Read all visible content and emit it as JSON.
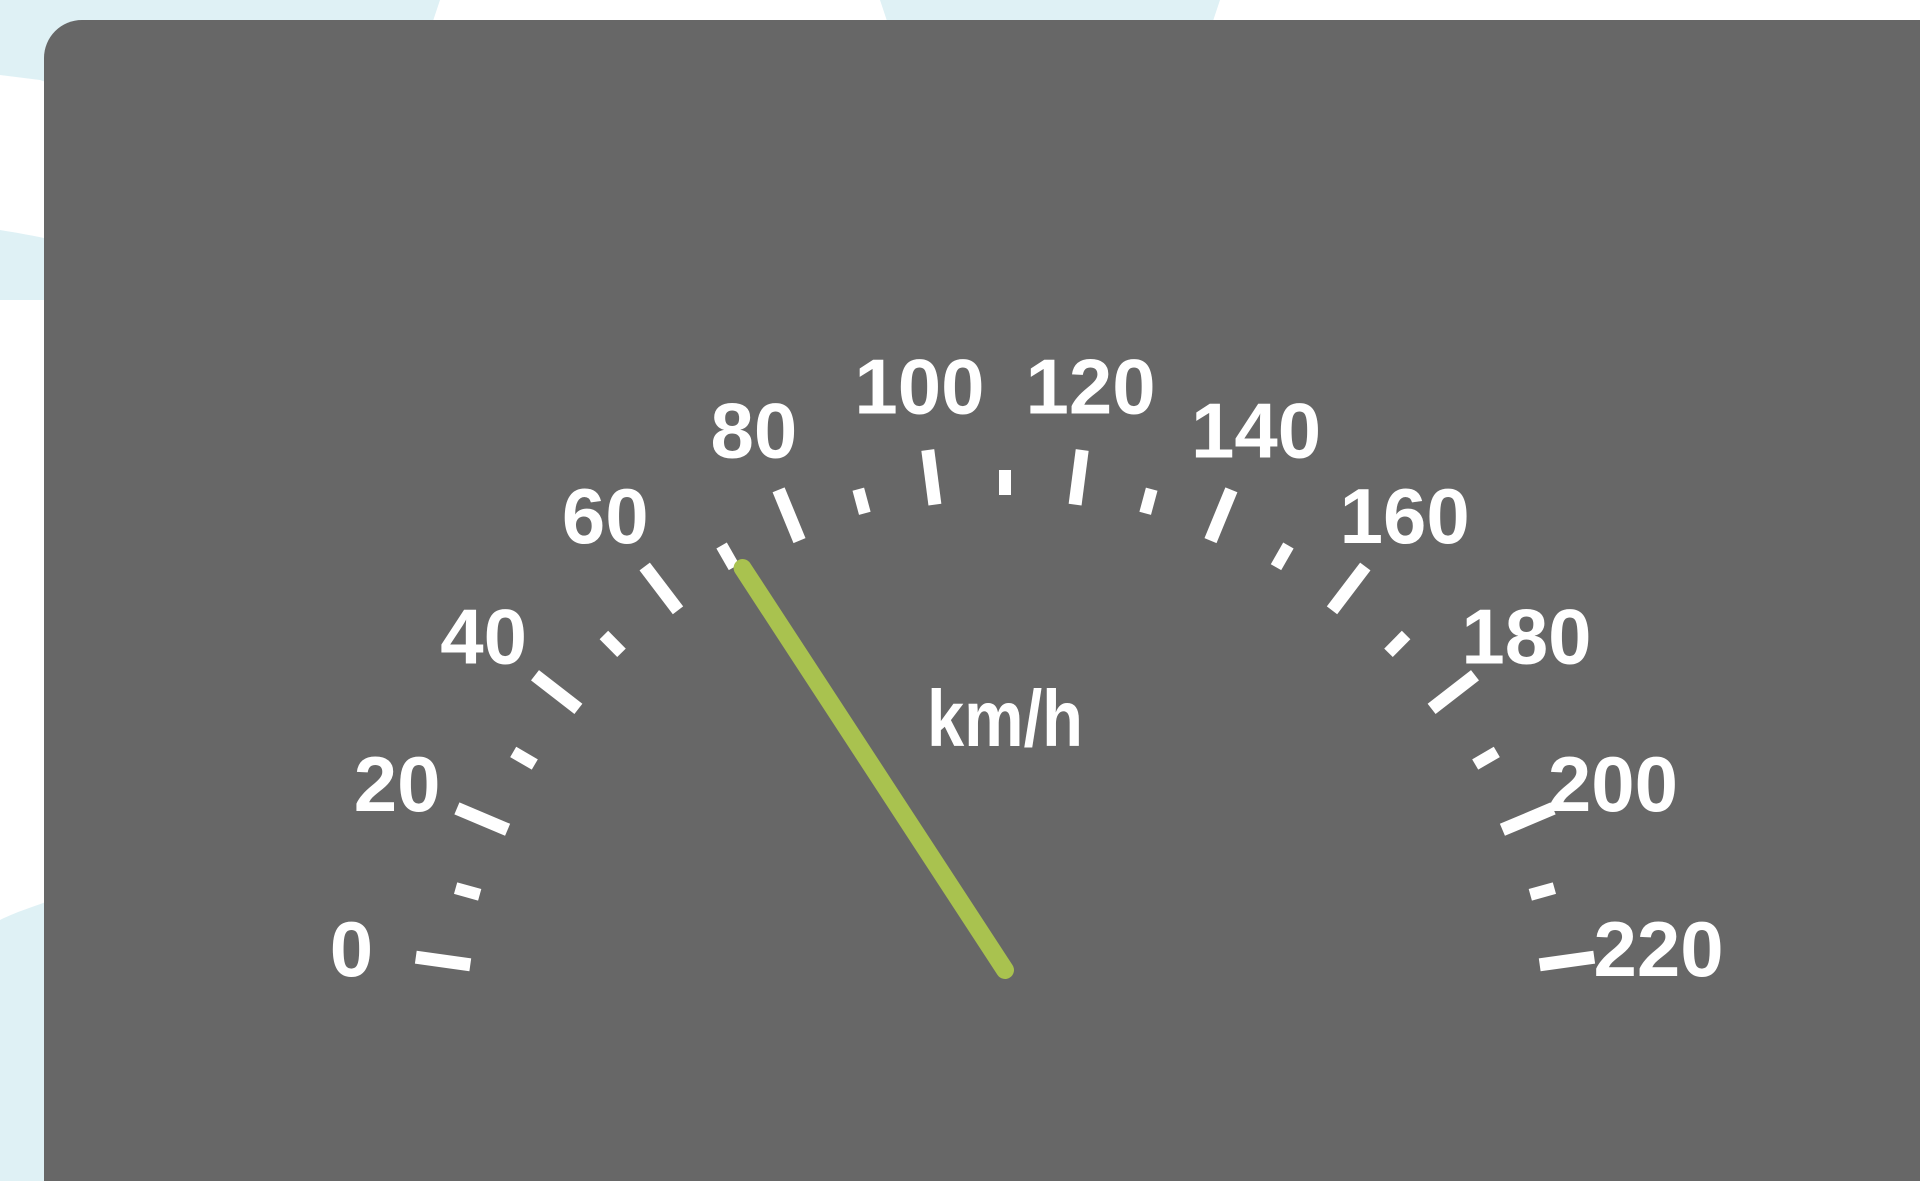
{
  "gauge": {
    "unit": "km/h",
    "min": 0,
    "max": 220,
    "major_step": 20,
    "minor_step": 10,
    "labels": [
      "0",
      "20",
      "40",
      "60",
      "80",
      "100",
      "120",
      "140",
      "160",
      "180",
      "200",
      "220"
    ],
    "needle_value": 71
  },
  "colors": {
    "panel": "#676767",
    "ticks": "#ffffff",
    "needle": "#a9c24f",
    "background_accent": "#dff1f5"
  }
}
